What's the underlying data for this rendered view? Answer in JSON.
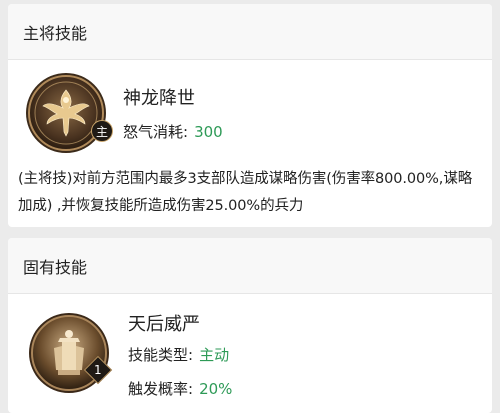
{
  "main_skill": {
    "section_title": "主将技能",
    "name": "神龙降世",
    "cost_label": "怒气消耗:",
    "cost_value": "300",
    "badge": "主",
    "icon": "phoenix-emblem-icon",
    "description": "(主将技)对前方范围内最多3支部队造成谋略伤害(伤害率800.00%,谋略加成) ,并恢复技能所造成伤害25.00%的兵力"
  },
  "innate_skill": {
    "section_title": "固有技能",
    "name": "天后威严",
    "type_label": "技能类型:",
    "type_value": "主动",
    "trigger_label": "触发概率:",
    "trigger_value": "20%",
    "badge": "1",
    "icon": "empress-throne-icon"
  },
  "colors": {
    "accent_value": "#2e9a57",
    "icon_bronze": "#7a5a33"
  }
}
